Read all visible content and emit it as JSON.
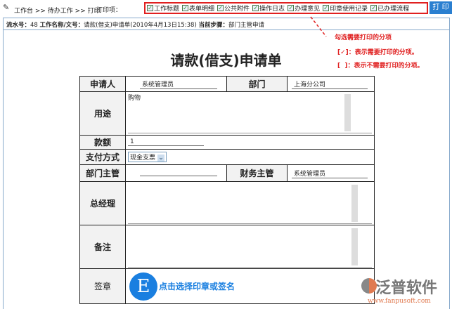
{
  "breadcrumb": "工作台 >> 待办工作 >> 打印",
  "print_label": "打印项：",
  "options": [
    {
      "label": "工作标题",
      "checked": true
    },
    {
      "label": "表单明细",
      "checked": true
    },
    {
      "label": "公共附件",
      "checked": true
    },
    {
      "label": "操作日志",
      "checked": true
    },
    {
      "label": "办理意见",
      "checked": true
    },
    {
      "label": "印章使用记录",
      "checked": true
    },
    {
      "label": "已办理流程",
      "checked": true
    }
  ],
  "print_button": "打 印",
  "info": {
    "serial_label": "流水号：",
    "serial": "48",
    "name_label": "工作名称/文号：",
    "name": "请款(借支)申请单(2010年4月13日15:38)",
    "step_label": "当前步骤：",
    "step": "部门主管申请"
  },
  "annotations": {
    "title": "勾选需要打印的分项",
    "checked": "：表示需要打印的分项。",
    "unchecked": "：表示不需要打印的分项。"
  },
  "form": {
    "title": "请款(借支)申请单",
    "applicant_label": "申请人",
    "applicant": "系统管理员",
    "dept_label": "部门",
    "dept": "上海分公司",
    "purpose_label": "用途",
    "purpose": "购物",
    "amount_label": "款额",
    "amount": "1",
    "payment_label": "支付方式",
    "payment": "现金支票",
    "dept_mgr_label": "部门主管",
    "dept_mgr": "",
    "fin_mgr_label": "财务主管",
    "fin_mgr": "系统管理员",
    "gm_label": "总经理",
    "remark_label": "备注",
    "seal_label": "签章",
    "seal_button": "点击选择印章或签名"
  },
  "logo": {
    "name": "泛普软件",
    "url": "www.fanpusoft.com"
  }
}
